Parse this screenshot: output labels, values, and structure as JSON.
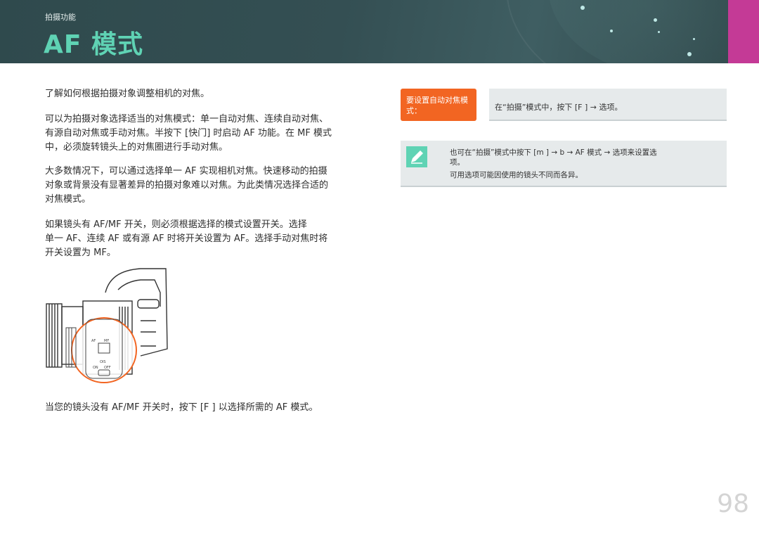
{
  "header": {
    "breadcrumb": "拍摄功能",
    "title": "AF 模式",
    "accent_color": "#5fd3b4",
    "tab_color": "#c43a96"
  },
  "body": {
    "para1": "了解如何根据拍摄对象调整相机的对焦。",
    "para2": [
      "可以为拍摄对象选择适当的对焦模式：单一自动对焦、连续自动对焦、",
      "有源自动对焦或手动对焦。半按下 [快门] 时启动 AF 功能。在 MF 模式",
      "中，必须旋转镜头上的对焦圈进行手动对焦。"
    ],
    "para3": [
      "大多数情况下，可以通过选择单一 AF 实现相机对焦。快速移动的拍摄",
      "对象或背景没有显著差异的拍摄对象难以对焦。为此类情况选择合适的",
      "对焦模式。"
    ],
    "para4": [
      "如果镜头有 AF/MF 开关，则必须根据选择的模式设置开关。选择",
      "单一 AF、连续 AF 或有源 AF 时将开关设置为 AF。选择手动对焦时将",
      "开关设置为 MF。"
    ],
    "caption": "当您的镜头没有 AF/MF 开关时，按下 [F    ] 以选择所需的 AF 模式。"
  },
  "illustration": {
    "switch_labels": [
      "AF",
      "MF",
      "OIS",
      "ON",
      "OFF"
    ],
    "highlight_color": "#f26522"
  },
  "side": {
    "tip_label": "要设置自动对焦模式：",
    "tip_text": "在“拍摄”模式中，按下 [F    ] → 选项。",
    "note_line1": "也可在“拍摄”模式中按下 [m      ] → b    → AF 模式 → 选项来设置选",
    "note_line2": "项。",
    "note_line3": "可用选项可能因使用的镜头不同而各异。"
  },
  "page_number": "98"
}
